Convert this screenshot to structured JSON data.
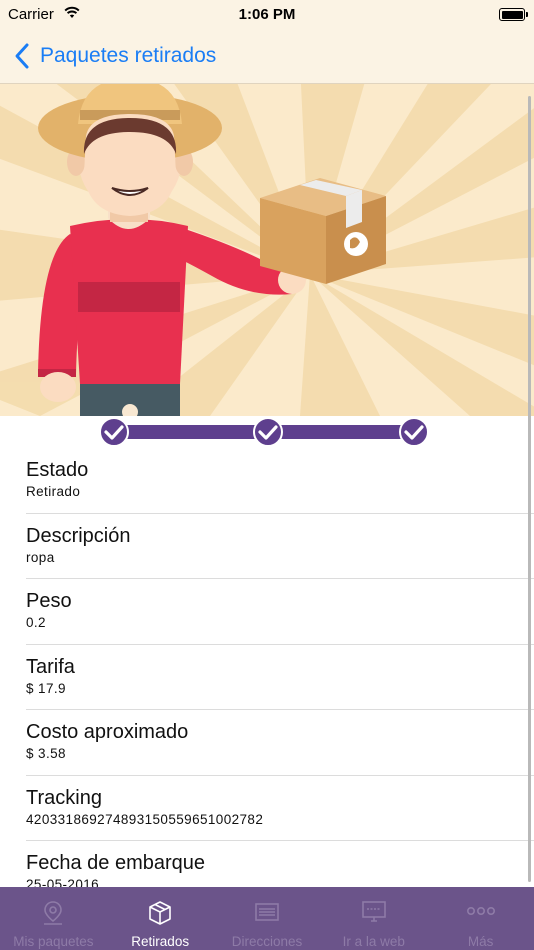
{
  "status_bar": {
    "carrier": "Carrier",
    "time": "1:06 PM"
  },
  "nav": {
    "back_label": "Paquetes retirados"
  },
  "colors": {
    "accent": "#1a7df5",
    "progress": "#5e3f8e",
    "tabbar": "#6b548a",
    "hero_bg": "#fbeacb"
  },
  "progress": {
    "steps_completed": 3,
    "steps_total": 3
  },
  "details": [
    {
      "label": "Estado",
      "value": "Retirado"
    },
    {
      "label": "Descripción",
      "value": "ropa"
    },
    {
      "label": "Peso",
      "value": "0.2"
    },
    {
      "label": "Tarifa",
      "value": "$ 17.9"
    },
    {
      "label": "Costo aproximado",
      "value": "$ 3.58"
    },
    {
      "label": "Tracking",
      "value": "420331869274893150559651002782"
    },
    {
      "label": "Fecha de embarque",
      "value": "25-05-2016"
    }
  ],
  "tabs": [
    {
      "label": "Mis paquetes",
      "icon": "map-pin-icon",
      "active": false
    },
    {
      "label": "Retirados",
      "icon": "box-icon",
      "active": true
    },
    {
      "label": "Direcciones",
      "icon": "address-card-icon",
      "active": false
    },
    {
      "label": "Ir a la web",
      "icon": "monitor-icon",
      "active": false
    },
    {
      "label": "Más",
      "icon": "more-dots-icon",
      "active": false
    }
  ]
}
